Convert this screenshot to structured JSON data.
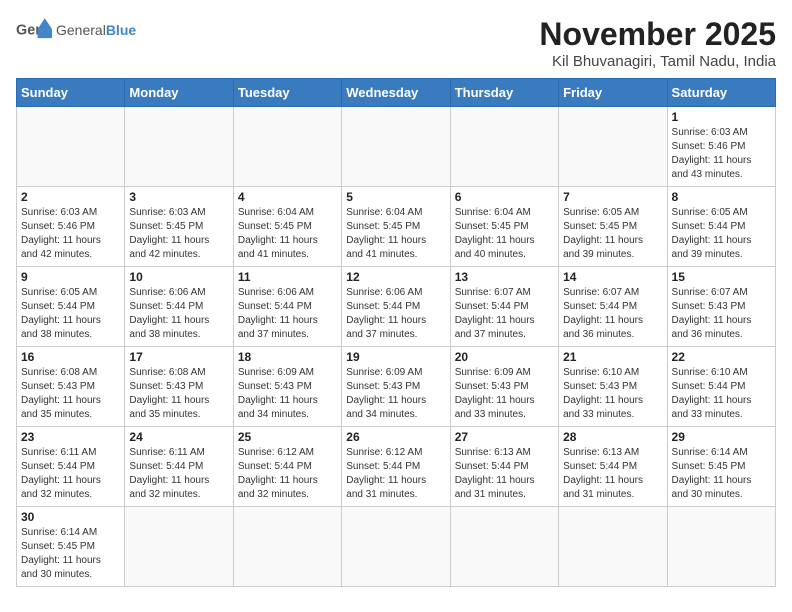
{
  "header": {
    "logo_general": "General",
    "logo_blue": "Blue",
    "month_title": "November 2025",
    "location": "Kil Bhuvanagiri, Tamil Nadu, India"
  },
  "weekdays": [
    "Sunday",
    "Monday",
    "Tuesday",
    "Wednesday",
    "Thursday",
    "Friday",
    "Saturday"
  ],
  "weeks": [
    [
      {
        "day": "",
        "info": ""
      },
      {
        "day": "",
        "info": ""
      },
      {
        "day": "",
        "info": ""
      },
      {
        "day": "",
        "info": ""
      },
      {
        "day": "",
        "info": ""
      },
      {
        "day": "",
        "info": ""
      },
      {
        "day": "1",
        "info": "Sunrise: 6:03 AM\nSunset: 5:46 PM\nDaylight: 11 hours\nand 43 minutes."
      }
    ],
    [
      {
        "day": "2",
        "info": "Sunrise: 6:03 AM\nSunset: 5:46 PM\nDaylight: 11 hours\nand 42 minutes."
      },
      {
        "day": "3",
        "info": "Sunrise: 6:03 AM\nSunset: 5:45 PM\nDaylight: 11 hours\nand 42 minutes."
      },
      {
        "day": "4",
        "info": "Sunrise: 6:04 AM\nSunset: 5:45 PM\nDaylight: 11 hours\nand 41 minutes."
      },
      {
        "day": "5",
        "info": "Sunrise: 6:04 AM\nSunset: 5:45 PM\nDaylight: 11 hours\nand 41 minutes."
      },
      {
        "day": "6",
        "info": "Sunrise: 6:04 AM\nSunset: 5:45 PM\nDaylight: 11 hours\nand 40 minutes."
      },
      {
        "day": "7",
        "info": "Sunrise: 6:05 AM\nSunset: 5:45 PM\nDaylight: 11 hours\nand 39 minutes."
      },
      {
        "day": "8",
        "info": "Sunrise: 6:05 AM\nSunset: 5:44 PM\nDaylight: 11 hours\nand 39 minutes."
      }
    ],
    [
      {
        "day": "9",
        "info": "Sunrise: 6:05 AM\nSunset: 5:44 PM\nDaylight: 11 hours\nand 38 minutes."
      },
      {
        "day": "10",
        "info": "Sunrise: 6:06 AM\nSunset: 5:44 PM\nDaylight: 11 hours\nand 38 minutes."
      },
      {
        "day": "11",
        "info": "Sunrise: 6:06 AM\nSunset: 5:44 PM\nDaylight: 11 hours\nand 37 minutes."
      },
      {
        "day": "12",
        "info": "Sunrise: 6:06 AM\nSunset: 5:44 PM\nDaylight: 11 hours\nand 37 minutes."
      },
      {
        "day": "13",
        "info": "Sunrise: 6:07 AM\nSunset: 5:44 PM\nDaylight: 11 hours\nand 37 minutes."
      },
      {
        "day": "14",
        "info": "Sunrise: 6:07 AM\nSunset: 5:44 PM\nDaylight: 11 hours\nand 36 minutes."
      },
      {
        "day": "15",
        "info": "Sunrise: 6:07 AM\nSunset: 5:43 PM\nDaylight: 11 hours\nand 36 minutes."
      }
    ],
    [
      {
        "day": "16",
        "info": "Sunrise: 6:08 AM\nSunset: 5:43 PM\nDaylight: 11 hours\nand 35 minutes."
      },
      {
        "day": "17",
        "info": "Sunrise: 6:08 AM\nSunset: 5:43 PM\nDaylight: 11 hours\nand 35 minutes."
      },
      {
        "day": "18",
        "info": "Sunrise: 6:09 AM\nSunset: 5:43 PM\nDaylight: 11 hours\nand 34 minutes."
      },
      {
        "day": "19",
        "info": "Sunrise: 6:09 AM\nSunset: 5:43 PM\nDaylight: 11 hours\nand 34 minutes."
      },
      {
        "day": "20",
        "info": "Sunrise: 6:09 AM\nSunset: 5:43 PM\nDaylight: 11 hours\nand 33 minutes."
      },
      {
        "day": "21",
        "info": "Sunrise: 6:10 AM\nSunset: 5:43 PM\nDaylight: 11 hours\nand 33 minutes."
      },
      {
        "day": "22",
        "info": "Sunrise: 6:10 AM\nSunset: 5:44 PM\nDaylight: 11 hours\nand 33 minutes."
      }
    ],
    [
      {
        "day": "23",
        "info": "Sunrise: 6:11 AM\nSunset: 5:44 PM\nDaylight: 11 hours\nand 32 minutes."
      },
      {
        "day": "24",
        "info": "Sunrise: 6:11 AM\nSunset: 5:44 PM\nDaylight: 11 hours\nand 32 minutes."
      },
      {
        "day": "25",
        "info": "Sunrise: 6:12 AM\nSunset: 5:44 PM\nDaylight: 11 hours\nand 32 minutes."
      },
      {
        "day": "26",
        "info": "Sunrise: 6:12 AM\nSunset: 5:44 PM\nDaylight: 11 hours\nand 31 minutes."
      },
      {
        "day": "27",
        "info": "Sunrise: 6:13 AM\nSunset: 5:44 PM\nDaylight: 11 hours\nand 31 minutes."
      },
      {
        "day": "28",
        "info": "Sunrise: 6:13 AM\nSunset: 5:44 PM\nDaylight: 11 hours\nand 31 minutes."
      },
      {
        "day": "29",
        "info": "Sunrise: 6:14 AM\nSunset: 5:45 PM\nDaylight: 11 hours\nand 30 minutes."
      }
    ],
    [
      {
        "day": "30",
        "info": "Sunrise: 6:14 AM\nSunset: 5:45 PM\nDaylight: 11 hours\nand 30 minutes."
      },
      {
        "day": "",
        "info": ""
      },
      {
        "day": "",
        "info": ""
      },
      {
        "day": "",
        "info": ""
      },
      {
        "day": "",
        "info": ""
      },
      {
        "day": "",
        "info": ""
      },
      {
        "day": "",
        "info": ""
      }
    ]
  ]
}
